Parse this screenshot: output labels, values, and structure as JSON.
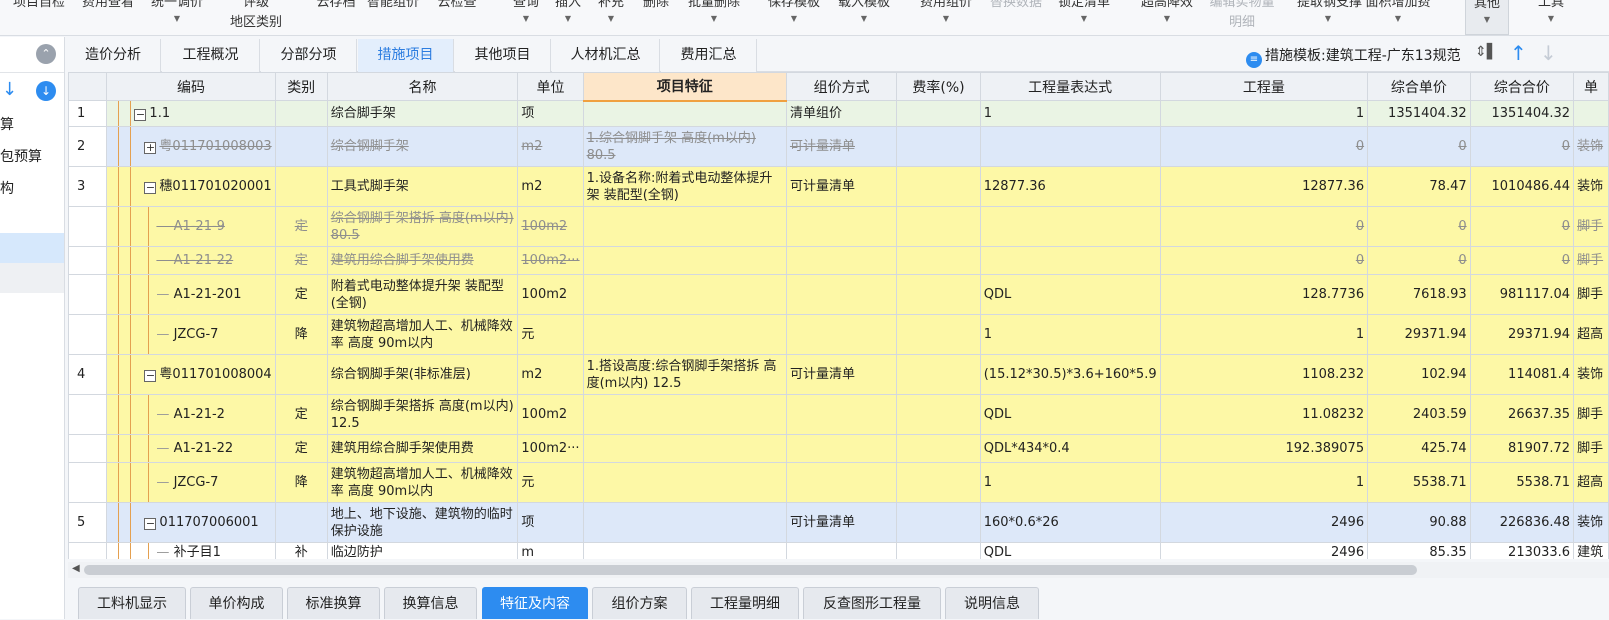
{
  "toolbar": {
    "items": [
      {
        "l1": "项目自检",
        "l2": ""
      },
      {
        "l1": "费用查看",
        "l2": ""
      },
      {
        "l1": "统一调价",
        "l2": ""
      },
      {
        "l1": "评级",
        "l2": "地区类别"
      },
      {
        "l1": "云存档",
        "l2": ""
      },
      {
        "l1": "智能组价",
        "l2": ""
      },
      {
        "l1": "云检查",
        "l2": ""
      },
      {
        "l1": "查询",
        "l2": ""
      },
      {
        "l1": "插入",
        "l2": ""
      },
      {
        "l1": "补充",
        "l2": ""
      },
      {
        "l1": "删除",
        "l2": ""
      },
      {
        "l1": "批量删除",
        "l2": ""
      },
      {
        "l1": "保存模板",
        "l2": ""
      },
      {
        "l1": "载入模板",
        "l2": ""
      },
      {
        "l1": "费用组价",
        "l2": ""
      },
      {
        "l1": "替换数据",
        "l2": ""
      },
      {
        "l1": "锁定清单",
        "l2": ""
      },
      {
        "l1": "超高降效",
        "l2": ""
      },
      {
        "l1": "编辑实物量",
        "l2": "明细"
      },
      {
        "l1": "提取钢支撑",
        "l2": ""
      },
      {
        "l1": "面积增加费",
        "l2": ""
      },
      {
        "l1": "其他",
        "l2": ""
      },
      {
        "l1": "工具",
        "l2": ""
      }
    ]
  },
  "left_panel": {
    "items": [
      "算",
      "包预算",
      "构",
      "",
      ""
    ]
  },
  "tabs": [
    "造价分析",
    "工程概况",
    "分部分项",
    "措施项目",
    "其他项目",
    "人材机汇总",
    "费用汇总"
  ],
  "active_tab": "措施项目",
  "template": {
    "label": "措施模板:建筑工程-广东13规范",
    "icon": "template-icon"
  },
  "grid": {
    "columns": [
      "编码",
      "类别",
      "名称",
      "单位",
      "项目特征",
      "组价方式",
      "费率(%)",
      "工程量表达式",
      "工程量",
      "综合单价",
      "综合合价",
      "单"
    ],
    "rows": [
      {
        "idx": "1",
        "code": "1.1",
        "toggle": "−",
        "level": 0,
        "type": "",
        "name": "综合脚手架",
        "unit": "项",
        "feature": "",
        "method": "清单组价",
        "rate": "",
        "expr": "1",
        "qty": "1",
        "price": "1351404.32",
        "total": "1351404.32",
        "extra": "",
        "style": "green"
      },
      {
        "idx": "2",
        "code": "粤011701008003",
        "toggle": "+",
        "level": 1,
        "type": "",
        "name": "综合钢脚手架",
        "unit": "m2",
        "feature": "1.综合钢脚手架 高度(m以内) 80.5",
        "method": "可计量清单",
        "rate": "",
        "expr": "",
        "qty": "0",
        "price": "0",
        "total": "0",
        "extra": "装饰",
        "style": "blue strike"
      },
      {
        "idx": "3",
        "code": "穗011701020001",
        "toggle": "−",
        "level": 1,
        "type": "",
        "name": "工具式脚手架",
        "unit": "m2",
        "feature": "1.设备名称:附着式电动整体提升架 装配型(全钢)",
        "method": "可计量清单",
        "rate": "",
        "expr": "12877.36",
        "qty": "12877.36",
        "price": "78.47",
        "total": "1010486.44",
        "extra": "装饰",
        "style": "yellow"
      },
      {
        "idx": "",
        "code": "A1-21-9",
        "toggle": "",
        "level": 2,
        "type": "定",
        "name": "综合钢脚手架搭拆 高度(m以内) 80.5",
        "unit": "100m2",
        "feature": "",
        "method": "",
        "rate": "",
        "expr": "",
        "qty": "0",
        "price": "0",
        "total": "0",
        "extra": "脚手",
        "style": "yellow strike"
      },
      {
        "idx": "",
        "code": "A1-21-22",
        "toggle": "",
        "level": 2,
        "type": "定",
        "name": "建筑用综合脚手架使用费",
        "unit": "100m2···",
        "feature": "",
        "method": "",
        "rate": "",
        "expr": "",
        "qty": "0",
        "price": "0",
        "total": "0",
        "extra": "脚手",
        "style": "yellow strike"
      },
      {
        "idx": "",
        "code": "A1-21-201",
        "toggle": "",
        "level": 2,
        "type": "定",
        "name": "附着式电动整体提升架 装配型(全钢)",
        "unit": "100m2",
        "feature": "",
        "method": "",
        "rate": "",
        "expr": "QDL",
        "qty": "128.7736",
        "price": "7618.93",
        "total": "981117.04",
        "extra": "脚手",
        "style": "yellow"
      },
      {
        "idx": "",
        "code": "JZCG-7",
        "toggle": "",
        "level": 2,
        "type": "降",
        "name": "建筑物超高增加人工、机械降效率 高度 90m以内",
        "unit": "元",
        "feature": "",
        "method": "",
        "rate": "",
        "expr": "1",
        "qty": "1",
        "price": "29371.94",
        "total": "29371.94",
        "extra": "超高",
        "style": "yellow"
      },
      {
        "idx": "4",
        "code": "粤011701008004",
        "toggle": "−",
        "level": 1,
        "type": "",
        "name": "综合钢脚手架(非标准层)",
        "unit": "m2",
        "feature": "1.搭设高度:综合钢脚手架搭拆 高度(m以内) 12.5",
        "method": "可计量清单",
        "rate": "",
        "expr": "(15.12*30.5)*3.6+160*5.9",
        "qty": "1108.232",
        "price": "102.94",
        "total": "114081.4",
        "extra": "装饰",
        "style": "yellow"
      },
      {
        "idx": "",
        "code": "A1-21-2",
        "toggle": "",
        "level": 2,
        "type": "定",
        "name": "综合钢脚手架搭拆 高度(m以内) 12.5",
        "unit": "100m2",
        "feature": "",
        "method": "",
        "rate": "",
        "expr": "QDL",
        "qty": "11.08232",
        "price": "2403.59",
        "total": "26637.35",
        "extra": "脚手",
        "style": "yellow"
      },
      {
        "idx": "",
        "code": "A1-21-22",
        "toggle": "",
        "level": 2,
        "type": "定",
        "name": "建筑用综合脚手架使用费",
        "unit": "100m2···",
        "feature": "",
        "method": "",
        "rate": "",
        "expr": "QDL*434*0.4",
        "qty": "192.389075",
        "price": "425.74",
        "total": "81907.72",
        "extra": "脚手",
        "style": "yellow"
      },
      {
        "idx": "",
        "code": "JZCG-7",
        "toggle": "",
        "level": 2,
        "type": "降",
        "name": "建筑物超高增加人工、机械降效率 高度 90m以内",
        "unit": "元",
        "feature": "",
        "method": "",
        "rate": "",
        "expr": "1",
        "qty": "1",
        "price": "5538.71",
        "total": "5538.71",
        "extra": "超高",
        "style": "yellow"
      },
      {
        "idx": "5",
        "code": "011707006001",
        "toggle": "−",
        "level": 1,
        "type": "",
        "name": "地上、地下设施、建筑物的临时保护设施",
        "unit": "项",
        "feature": "",
        "method": "可计量清单",
        "rate": "",
        "expr": "160*0.6*26",
        "qty": "2496",
        "price": "90.88",
        "total": "226836.48",
        "extra": "装饰",
        "style": "blue"
      },
      {
        "idx": "",
        "code": "补子目1",
        "toggle": "",
        "level": 2,
        "type": "补",
        "name": "临边防护",
        "unit": "m",
        "feature": "",
        "method": "",
        "rate": "",
        "expr": "QDL",
        "qty": "2496",
        "price": "85.35",
        "total": "213033.6",
        "extra": "建筑",
        "style": "white"
      }
    ]
  },
  "bottom_tabs": [
    "工料机显示",
    "单价构成",
    "标准换算",
    "换算信息",
    "特征及内容",
    "组价方案",
    "工程量明细",
    "反查图形工程量",
    "说明信息"
  ],
  "active_bottom_tab": "特征及内容"
}
